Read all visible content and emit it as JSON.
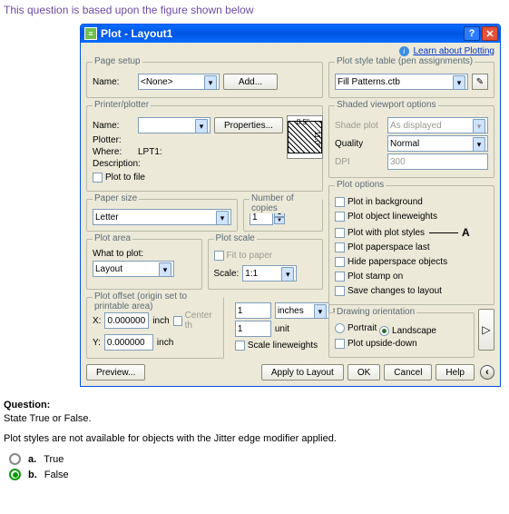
{
  "intro": "This question is based upon the figure shown below",
  "titlebar": {
    "title": "Plot - Layout1"
  },
  "learn": {
    "text": "Learn about Plotting"
  },
  "pageSetup": {
    "title": "Page setup",
    "nameLabel": "Name:",
    "nameValue": "<None>",
    "addBtn": "Add..."
  },
  "styleTable": {
    "title": "Plot style table (pen assignments)",
    "value": "Fill Patterns.ctb"
  },
  "printer": {
    "title": "Printer/plotter",
    "nameLabel": "Name:",
    "nameValue": "",
    "propsBtn": "Properties...",
    "plotterLabel": "Plotter:",
    "whereLabel": "Where:",
    "whereValue": "LPT1:",
    "descLabel": "Description:",
    "plotToFile": "Plot to file",
    "previewW": "8.5\"",
    "previewH": "11.0\""
  },
  "shaded": {
    "title": "Shaded viewport options",
    "shadePlotLabel": "Shade plot",
    "shadePlotValue": "As displayed",
    "qualityLabel": "Quality",
    "qualityValue": "Normal",
    "dpiLabel": "DPI",
    "dpiValue": "300"
  },
  "paper": {
    "title": "Paper size",
    "value": "Letter"
  },
  "copies": {
    "title": "Number of copies",
    "value": "1"
  },
  "plotOptions": {
    "title": "Plot options",
    "items": [
      "Plot in background",
      "Plot object lineweights",
      "Plot with plot styles",
      "Plot paperspace last",
      "Hide paperspace objects",
      "Plot stamp on",
      "Save changes to layout"
    ]
  },
  "plotArea": {
    "title": "Plot area",
    "whatLabel": "What to plot:",
    "value": "Layout"
  },
  "plotScale": {
    "title": "Plot scale",
    "fitLabel": "Fit to paper",
    "scaleLabel": "Scale:",
    "scaleValue": "1:1",
    "topVal": "1",
    "topUnit": "inches",
    "botVal": "1",
    "botUnit": "unit",
    "scaleLW": "Scale lineweights"
  },
  "offset": {
    "title": "Plot offset (origin set to printable area)",
    "xLabel": "X:",
    "xValue": "0.000000",
    "xUnit": "inch",
    "centerLabel": "Center th",
    "yLabel": "Y:",
    "yValue": "0.000000",
    "yUnit": "inch"
  },
  "orient": {
    "title": "Drawing orientation",
    "portrait": "Portrait",
    "landscape": "Landscape",
    "upside": "Plot upside-down"
  },
  "footer": {
    "preview": "Preview...",
    "apply": "Apply to Layout",
    "ok": "OK",
    "cancel": "Cancel",
    "help": "Help"
  },
  "question": {
    "heading": "Question:",
    "prompt": "State True or False.",
    "body": "Plot styles are not available for objects with the Jitter edge modifier applied.",
    "answers": [
      {
        "letter": "a.",
        "text": "True"
      },
      {
        "letter": "b.",
        "text": "False"
      }
    ]
  },
  "callout": "A"
}
